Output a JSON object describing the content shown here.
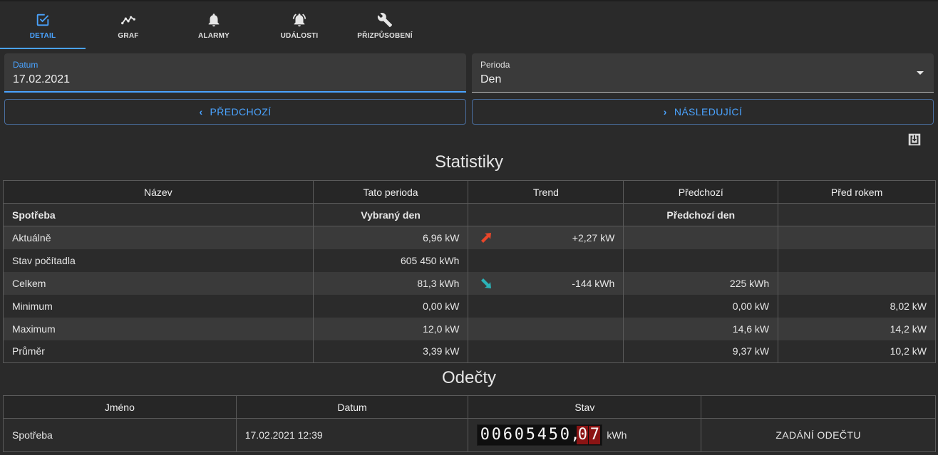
{
  "tabs": [
    {
      "label": "DETAIL",
      "icon": "checkbox-edit-icon"
    },
    {
      "label": "GRAF",
      "icon": "line-chart-icon"
    },
    {
      "label": "ALARMY",
      "icon": "bell-icon"
    },
    {
      "label": "UDÁLOSTI",
      "icon": "bell-ring-icon"
    },
    {
      "label": "PŘIZPŮSOBENÍ",
      "icon": "wrench-icon"
    }
  ],
  "active_tab": "DETAIL",
  "accent_color": "#4aa3ff",
  "date_field": {
    "label": "Datum",
    "value": "17.02.2021"
  },
  "period_field": {
    "label": "Perioda",
    "value": "Den"
  },
  "nav": {
    "prev": "PŘEDCHOZÍ",
    "next": "NÁSLEDUJÍCÍ"
  },
  "stats": {
    "title": "Statistiky",
    "headers": [
      "Název",
      "Tato perioda",
      "Trend",
      "Předchozí",
      "Před rokem"
    ],
    "subheader": [
      "Spotřeba",
      "Vybraný den",
      "",
      "Předchozí den",
      ""
    ],
    "rows": [
      {
        "name": "Aktuálně",
        "current": "6,96 kW",
        "trend": "+2,27 kW",
        "trend_dir": "up",
        "previous": "",
        "year_ago": ""
      },
      {
        "name": "Stav počítadla",
        "current": "605 450 kWh",
        "trend": "",
        "trend_dir": "",
        "previous": "",
        "year_ago": ""
      },
      {
        "name": "Celkem",
        "current": "81,3 kWh",
        "trend": "-144 kWh",
        "trend_dir": "down",
        "previous": "225 kWh",
        "year_ago": ""
      },
      {
        "name": "Minimum",
        "current": "0,00 kW",
        "trend": "",
        "trend_dir": "",
        "previous": "0,00 kW",
        "year_ago": "8,02 kW"
      },
      {
        "name": "Maximum",
        "current": "12,0 kW",
        "trend": "",
        "trend_dir": "",
        "previous": "14,6 kW",
        "year_ago": "14,2 kW"
      },
      {
        "name": "Průměr",
        "current": "3,39 kW",
        "trend": "",
        "trend_dir": "",
        "previous": "9,37 kW",
        "year_ago": "10,2 kW"
      }
    ],
    "trend_colors": {
      "up": "#e8462a",
      "down": "#2bb3b8"
    }
  },
  "readings": {
    "title": "Odečty",
    "headers": [
      "Jméno",
      "Datum",
      "Stav",
      ""
    ],
    "row": {
      "name": "Spotřeba",
      "date": "17.02.2021 12:39",
      "meter_integer": "00605450",
      "meter_sep": ",",
      "meter_decimal": "07",
      "unit": "kWh",
      "action": "ZADÁNÍ ODEČTU"
    }
  }
}
